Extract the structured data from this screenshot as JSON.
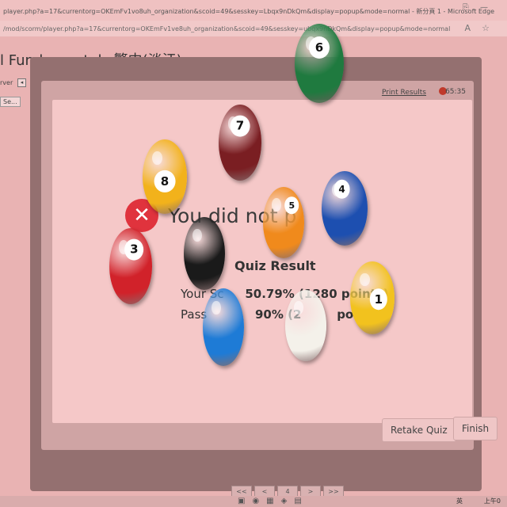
{
  "browser": {
    "title_url": "player.php?a=17&currentorg=OKEmFv1vo8uh_organization&scoid=49&sesskey=Lbqx9nDkQm&display=popup&mode=normal - 新分頁 1 - Microsoft Edge",
    "address_url": "/mod/scorm/player.php?a=17&currentorg=OKEmFv1ve8uh_organization&scoid=49&sesskey=ubqx9nDkQm&display=popup&mode=normal"
  },
  "page": {
    "title": "l Fundamentals 繁中(淡江)",
    "sidebar_server_label": "rver",
    "sidebar_button_label": "Se..."
  },
  "quiz": {
    "print_results": "Print Results",
    "timer": "65:35",
    "fail_message": "You did not p",
    "result_title": "Quiz Result",
    "score_label": "Your Sc",
    "score_value": "50.79% (1280 points)",
    "pass_label": "Pass",
    "pass_value": "90% (2",
    "pass_value_tail": "points)",
    "retake_label": "Retake Quiz",
    "finish_label": "Finish"
  },
  "pager": [
    "<<",
    "<",
    "4",
    ">",
    ">>"
  ],
  "taskbar": {
    "ime": "英",
    "time": "上午0"
  },
  "balls": [
    {
      "number": "6",
      "color": "#1f7a3f"
    },
    {
      "number": "7",
      "color": "#7a1e22"
    },
    {
      "number": "8",
      "color": "#f2b21b"
    },
    {
      "number": "5",
      "color": "#f08a1c"
    },
    {
      "number": "4",
      "color": "#1d4fb0"
    },
    {
      "number": "3",
      "color": "#d1222a"
    },
    {
      "number": "",
      "color": "#1a1a1a"
    },
    {
      "number": "1",
      "color": "#f2c21e"
    },
    {
      "number": "",
      "color": "#1e7bd6"
    },
    {
      "number": "",
      "color": "#f4f1ea"
    }
  ],
  "colors": {
    "accent_red": "#e0333d",
    "frame": "#947070",
    "card": "#f5c8c8"
  }
}
